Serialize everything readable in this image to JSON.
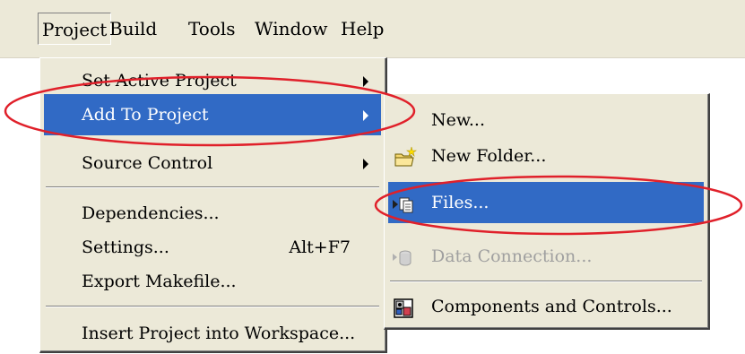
{
  "menubar": {
    "items": [
      {
        "label": "Project",
        "mnemonic": "P"
      },
      {
        "label": "Build",
        "mnemonic": "B"
      },
      {
        "label": "Tools",
        "mnemonic": "T"
      },
      {
        "label": "Window",
        "mnemonic": "W"
      },
      {
        "label": "Help",
        "mnemonic": "H"
      }
    ]
  },
  "project_menu": {
    "items": [
      {
        "label": "Set Active Project",
        "submenu": true
      },
      {
        "label": "Add To Project",
        "submenu": true,
        "highlighted": true
      },
      {
        "label": "Source Control",
        "submenu": true
      },
      {
        "label": "Dependencies..."
      },
      {
        "label": "Settings...",
        "accelerator": "Alt+F7"
      },
      {
        "label": "Export Makefile..."
      },
      {
        "label": "Insert Project into Workspace..."
      }
    ]
  },
  "add_to_project_submenu": {
    "items": [
      {
        "label": "New...",
        "icon": "none"
      },
      {
        "label": "New Folder...",
        "icon": "new-folder-icon"
      },
      {
        "label": "Files...",
        "icon": "add-files-icon",
        "highlighted": true
      },
      {
        "label": "Data Connection...",
        "icon": "data-connection-icon",
        "disabled": true
      },
      {
        "label": "Components and Controls...",
        "icon": "components-icon"
      }
    ]
  },
  "colors": {
    "menu_bg": "#ece9d8",
    "highlight": "#316ac5",
    "annotation": "#e0202a",
    "disabled_text": "#a0a0a0"
  }
}
